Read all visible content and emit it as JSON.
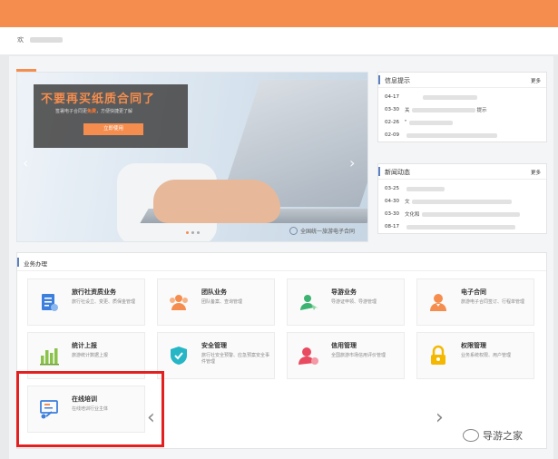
{
  "header": {
    "welcome_text": "欢"
  },
  "banner": {
    "headline": "不要再买纸质合同了",
    "sub_pre": "签署电子合同更",
    "sub_hl": "免费",
    "sub_post": "，方便快捷更了解",
    "cta_label": "立即使用",
    "caption": "全国统一旅游电子合同",
    "left_arrow": "‹",
    "right_arrow": "›",
    "colors": {
      "accent": "#f58d4e"
    }
  },
  "info_panel": {
    "title": "信息提示",
    "more": "更多",
    "rows": [
      {
        "date": "04-17",
        "title": "",
        "tail": ""
      },
      {
        "date": "03-30",
        "title": "关",
        "tail": "提示"
      },
      {
        "date": "02-26",
        "title": "\"",
        "tail": ""
      },
      {
        "date": "02-09",
        "title": "",
        "tail": ""
      }
    ]
  },
  "news_panel": {
    "title": "新闻动态",
    "more": "更多",
    "rows": [
      {
        "date": "03-25",
        "title": "",
        "tail": ""
      },
      {
        "date": "04-30",
        "title": "文",
        "tail": ""
      },
      {
        "date": "03-30",
        "title": "文化和",
        "tail": ""
      },
      {
        "date": "08-17",
        "title": "",
        "tail": ""
      }
    ]
  },
  "business": {
    "title": "业务办理",
    "cards": [
      {
        "name": "旅行社资质业务",
        "desc": "旅行社设立、变更、质保金管理",
        "icon": "document-icon",
        "color": "#3d7fdc"
      },
      {
        "name": "团队业务",
        "desc": "团队备案、查询管理",
        "icon": "team-icon",
        "color": "#f58d4e"
      },
      {
        "name": "导游业务",
        "desc": "导游证申领、导游管理",
        "icon": "guide-icon",
        "color": "#3cb371"
      },
      {
        "name": "电子合同",
        "desc": "旅游电子合同签订、行程单管理",
        "icon": "user-icon",
        "color": "#f58d4e"
      },
      {
        "name": "统计上报",
        "desc": "旅游统计数据上报",
        "icon": "bar-chart-icon",
        "color": "#8bc34a"
      },
      {
        "name": "安全管理",
        "desc": "旅行社安全预警、应急预案安全事件管理",
        "icon": "shield-icon",
        "color": "#26b6c6"
      },
      {
        "name": "信用管理",
        "desc": "全国旅游市场信用评价管理",
        "icon": "credit-user-icon",
        "color": "#e84a5f"
      },
      {
        "name": "权限管理",
        "desc": "业务系统权限、用户管理",
        "icon": "lock-icon",
        "color": "#f5b800"
      },
      {
        "name": "在线培训",
        "desc": "在线培训行业主体",
        "icon": "training-icon",
        "color": "#3d7fdc"
      }
    ],
    "prev_arrow": "‹",
    "next_arrow": "›"
  },
  "watermark": {
    "text": "导游之家",
    "icon": "wechat-icon"
  }
}
